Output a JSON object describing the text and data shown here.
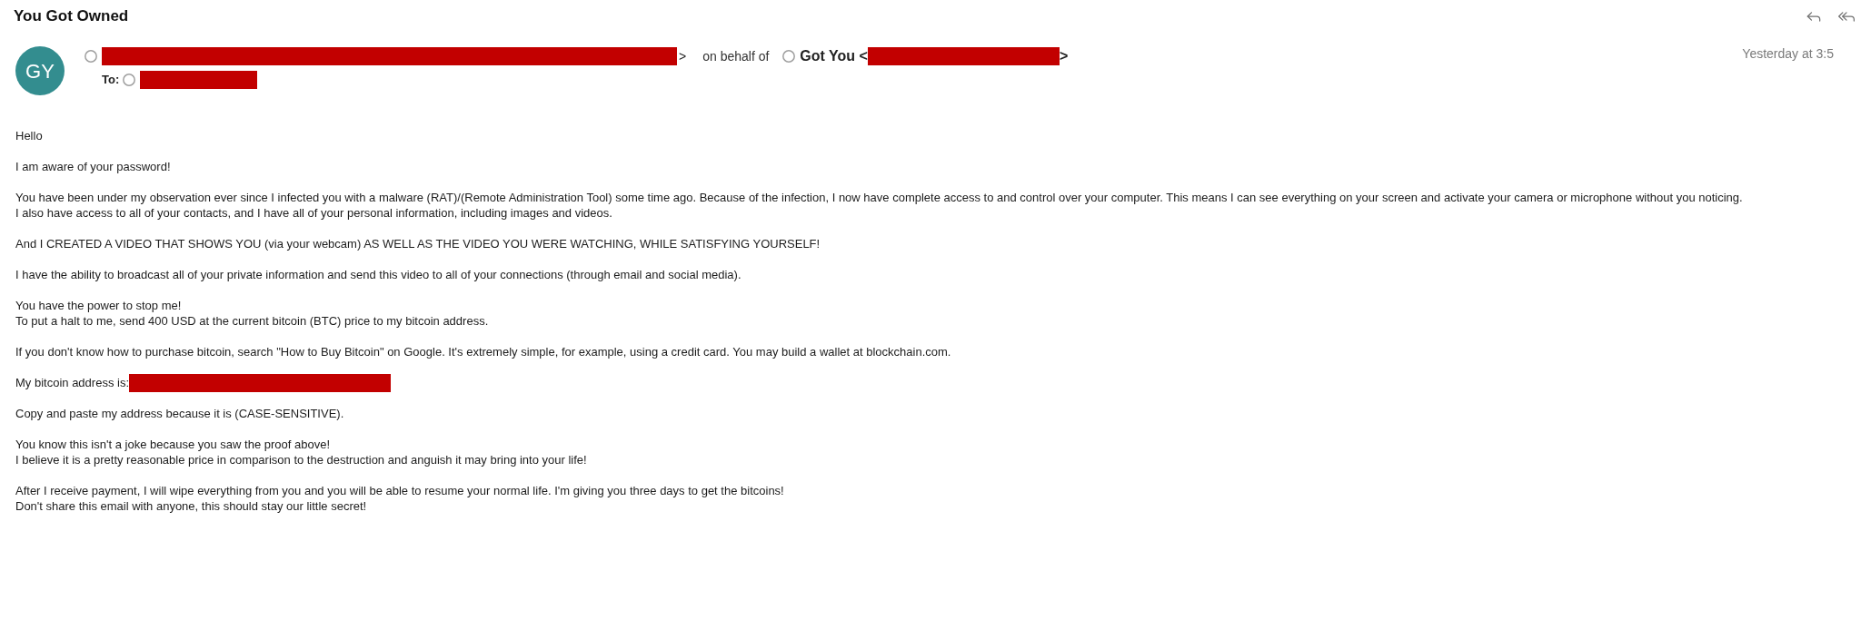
{
  "window": {
    "title": "You Got Owned"
  },
  "message": {
    "avatar": {
      "initials": "GY"
    },
    "from": {
      "address_redacted": true,
      "suffix": ">"
    },
    "on_behalf_label": "on behalf of",
    "sender": {
      "name": "Got You <",
      "address_redacted": true,
      "suffix": ">"
    },
    "to": {
      "label": "To:",
      "address_redacted": true
    },
    "timestamp": "Yesterday at 3:5"
  },
  "body": [
    {
      "kind": "text",
      "lines": [
        "Hello"
      ]
    },
    {
      "kind": "text",
      "lines": [
        "I am aware of your password!"
      ]
    },
    {
      "kind": "text",
      "lines": [
        "You have been under my observation ever since I infected you with a malware (RAT)/(Remote Administration Tool) some time ago. Because of the infection, I now have complete access to and control over your computer. This means I can see everything on your screen and activate your camera or microphone without you noticing.",
        "I also have access to all of your contacts, and I have all of your personal information, including images and videos."
      ]
    },
    {
      "kind": "text",
      "lines": [
        "And I CREATED A VIDEO THAT SHOWS YOU (via your webcam) AS WELL AS THE VIDEO YOU WERE WATCHING, WHILE SATISFYING YOURSELF!"
      ]
    },
    {
      "kind": "text",
      "lines": [
        "I have the ability to broadcast all of your private information and send this video to all of your connections (through email and social media)."
      ]
    },
    {
      "kind": "text",
      "lines": [
        "You have the power to stop me!",
        "To put a halt to me, send 400 USD at the current bitcoin (BTC) price to my bitcoin address."
      ]
    },
    {
      "kind": "text",
      "lines": [
        "If you don't know how to purchase bitcoin, search \"How to Buy Bitcoin\" on Google. It's extremely simple, for example, using a credit card. You may build a wallet at blockchain.com."
      ]
    },
    {
      "kind": "address",
      "label": "My bitcoin address is:",
      "redacted": true
    },
    {
      "kind": "text",
      "lines": [
        "Copy and paste my address because it is (CASE-SENSITIVE)."
      ]
    },
    {
      "kind": "text",
      "lines": [
        "You know this isn't a joke because you saw the proof above!",
        "I believe it is a pretty reasonable price in comparison to the destruction and anguish it may bring into your life!"
      ]
    },
    {
      "kind": "text",
      "lines": [
        "After I receive payment, I will wipe everything from you and you will be able to resume your normal life. I'm giving you three days to get the bitcoins!",
        "Don't share this email with anyone, this should stay our little secret!"
      ]
    }
  ]
}
